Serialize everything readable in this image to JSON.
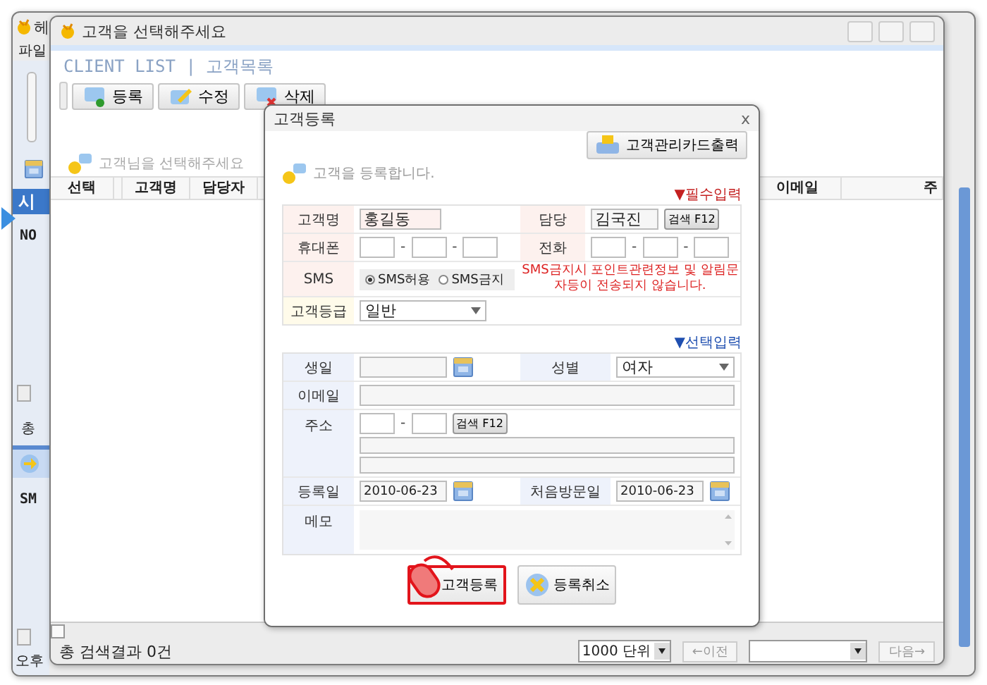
{
  "back_window": {
    "title": "헤",
    "menu": [
      "파일"
    ],
    "tab": "시",
    "row": "NO",
    "summary": "총",
    "item": "SM",
    "footer": "오후"
  },
  "list_window": {
    "title": "고객을 선택해주세요",
    "heading": "CLIENT LIST | 고객목록",
    "toolbar": [
      {
        "label": "등록",
        "kind": "add"
      },
      {
        "label": "수정",
        "kind": "edit"
      },
      {
        "label": "삭제",
        "kind": "delete"
      }
    ],
    "prompt": "고객님을 선택해주세요",
    "columns": [
      {
        "label": "선택"
      },
      {
        "label": "고객명"
      },
      {
        "label": "담당자"
      },
      {
        "label": "이메일"
      },
      {
        "label": "주"
      }
    ],
    "status": "총 검색결과 0건",
    "page_size": "1000 단위",
    "prev": {
      "label": "←이전",
      "disabled": true
    },
    "next": {
      "label": "다음→",
      "disabled": true
    }
  },
  "dialog": {
    "title": "고객등록",
    "close": "x",
    "print_button": "고객관리카드출력",
    "intro": "고객을 등록합니다.",
    "required_label": "▼필수입력",
    "optional_label": "▼선택입력",
    "name": {
      "label": "고객명",
      "value": "홍길동"
    },
    "staff": {
      "label": "담당",
      "value": "김국진",
      "button": "검색 F12"
    },
    "mobile": {
      "label": "휴대폰",
      "separator": "-"
    },
    "phone": {
      "label": "전화",
      "separator": "-"
    },
    "sms": {
      "label": "SMS",
      "options": [
        {
          "label": "SMS허용",
          "selected": true
        },
        {
          "label": "SMS금지",
          "selected": false
        }
      ],
      "note": "SMS금지시 포인트관련정보 및 알림문자등이 전송되지 않습니다."
    },
    "grade": {
      "label": "고객등급",
      "value": "일반"
    },
    "birthday": {
      "label": "생일"
    },
    "gender": {
      "label": "성별",
      "value": "여자"
    },
    "email": {
      "label": "이메일"
    },
    "address": {
      "label": "주소",
      "separator": "-",
      "button": "검색 F12"
    },
    "registered": {
      "label": "등록일",
      "value": "2010-06-23"
    },
    "first_visit": {
      "label": "처음방문일",
      "value": "2010-06-23"
    },
    "memo": {
      "label": "메모"
    },
    "buttons": [
      {
        "label": "고객등록",
        "kind": "register",
        "highlighted": true
      },
      {
        "label": "등록취소",
        "kind": "cancel",
        "highlighted": false
      }
    ]
  }
}
